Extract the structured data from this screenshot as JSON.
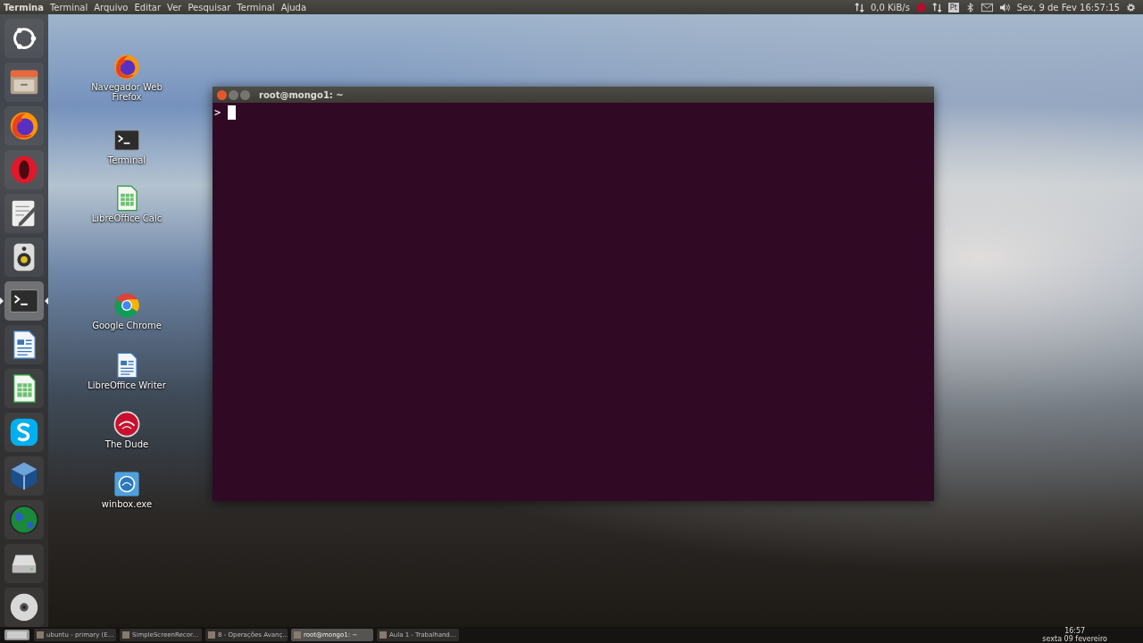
{
  "top_bar": {
    "app_name": "Termina",
    "menus": [
      "Terminal",
      "Arquivo",
      "Editar",
      "Ver",
      "Pesquisar",
      "Terminal",
      "Ajuda"
    ],
    "network_speed": "0,0 KiB/s",
    "keyboard_layout": "Pt",
    "clock": "Sex, 9 de Fev 16:57:15"
  },
  "launcher": [
    {
      "kind": "ubuntu",
      "focused": false
    },
    {
      "kind": "files",
      "focused": false
    },
    {
      "kind": "firefox",
      "focused": false
    },
    {
      "kind": "opera",
      "focused": false
    },
    {
      "kind": "editor",
      "focused": false
    },
    {
      "kind": "speaker",
      "focused": false
    },
    {
      "kind": "terminal",
      "focused": true
    },
    {
      "kind": "writer",
      "focused": false
    },
    {
      "kind": "calc",
      "focused": false
    },
    {
      "kind": "skype",
      "focused": false
    },
    {
      "kind": "virtualbox",
      "focused": false
    },
    {
      "kind": "globe",
      "focused": false
    },
    {
      "kind": "drive",
      "focused": false
    },
    {
      "kind": "disc",
      "focused": false
    }
  ],
  "desktop_icons": [
    {
      "kind": "firefox",
      "label": "Navegador Web Firefox"
    },
    {
      "kind": "terminal",
      "label": "Terminal"
    },
    {
      "kind": "calc",
      "label": "LibreOffice Calc"
    },
    {
      "kind": "chrome",
      "label": "Google Chrome"
    },
    {
      "kind": "writer",
      "label": "LibreOffice Writer"
    },
    {
      "kind": "dude",
      "label": "The Dude"
    },
    {
      "kind": "winbox",
      "label": "winbox.exe"
    }
  ],
  "terminal": {
    "title": "root@mongo1: ~",
    "prompt": ">"
  },
  "taskbar": {
    "items": [
      {
        "label": "ubuntu - primary (E...",
        "selected": false
      },
      {
        "label": "SimpleScreenRecor...",
        "selected": false
      },
      {
        "label": "8 - Operações Avanç...",
        "selected": false
      },
      {
        "label": "root@mongo1: ~",
        "selected": true
      },
      {
        "label": "Aula 1 - Trabalhand...",
        "selected": false
      }
    ],
    "time": "16:57",
    "date": "sexta 09 fevereiro"
  }
}
